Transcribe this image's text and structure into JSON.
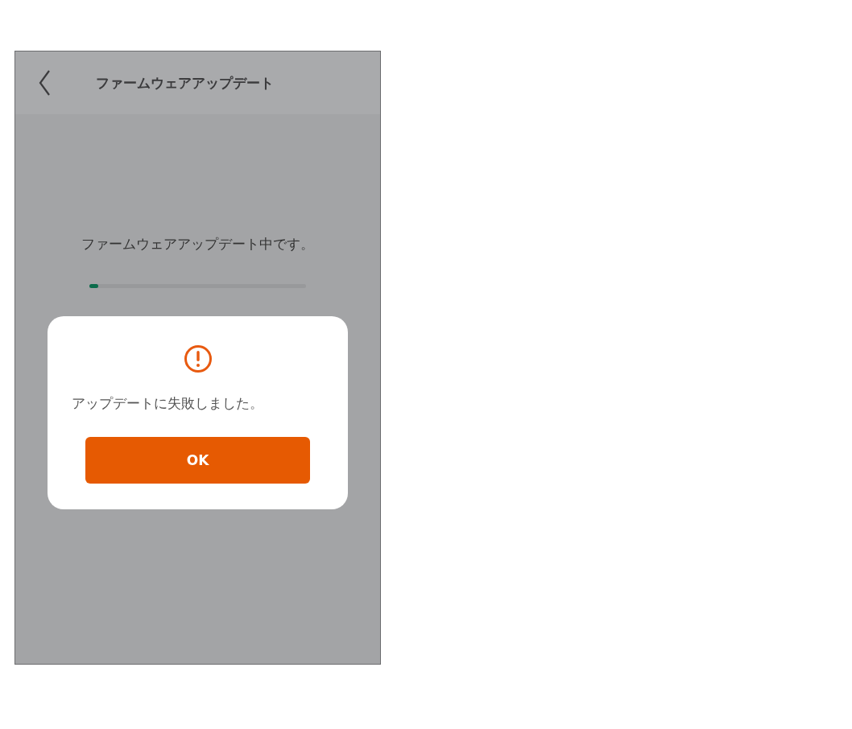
{
  "header": {
    "title": "ファームウェアアップデート"
  },
  "content": {
    "message": "ファームウェアアップデート中です。",
    "progress": {
      "level": 0.04
    }
  },
  "dialog": {
    "message": "アップデートに失敗しました。",
    "button": "OK"
  }
}
